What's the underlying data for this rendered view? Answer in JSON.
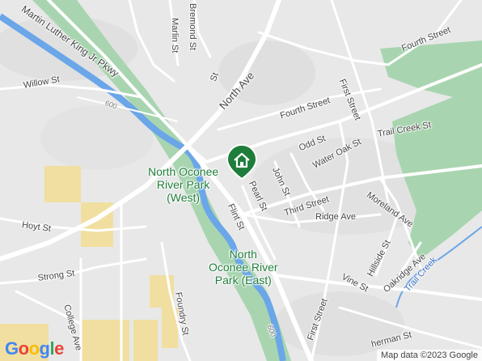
{
  "map": {
    "parks": [
      {
        "id": "west",
        "lines": [
          "North Oconee",
          "River Park",
          "(West)"
        ]
      },
      {
        "id": "east",
        "lines": [
          "North",
          "Oconee River",
          "Park (East)"
        ]
      }
    ],
    "streets": {
      "mlk": "Martin Luther King Jr Pkwy",
      "bremond": "Bremond St",
      "marlin": "Marlin St",
      "willow": "Willow St",
      "north_ave": "North Ave",
      "fourth_1": "Fourth Street",
      "fourth_2": "Fourth Street",
      "first_1": "First Street",
      "first_2": "First Street",
      "trail_creek": "Trail Creek St",
      "odd": "Odd St",
      "water_oak": "Water Oak St",
      "john": "John St",
      "pearl": "Pearl St",
      "flint": "Flint St",
      "third": "Third Street",
      "ridge": "Ridge Ave",
      "moreland": "Moreland Ave",
      "hillside": "Hillside St",
      "oakridge": "Oakridge Ave",
      "vine": "Vine St",
      "hoyt": "Hoyt St",
      "strong": "Strong St",
      "college": "College Ave",
      "foundry": "Foundry St",
      "sherman": "herman St",
      "ft_partial": "St"
    },
    "waterways": {
      "trail_creek": "Trail Creek"
    },
    "route_numbers": [
      "600",
      "600"
    ],
    "logo_letters": [
      "G",
      "o",
      "o",
      "g",
      "l",
      "e"
    ],
    "logo_colors": [
      "#4285F4",
      "#EA4335",
      "#FBBC05",
      "#4285F4",
      "#34A853",
      "#EA4335"
    ],
    "attribution": "Map data ©2023 Google",
    "colors": {
      "background": "#e8e8e8",
      "park": "#a8d5b0",
      "river": "#6aa6e8",
      "road": "#ffffff",
      "building_yellow": "#f0dfa0",
      "marker": "#1e7d3a"
    },
    "marker": {
      "label": "home-icon"
    }
  }
}
